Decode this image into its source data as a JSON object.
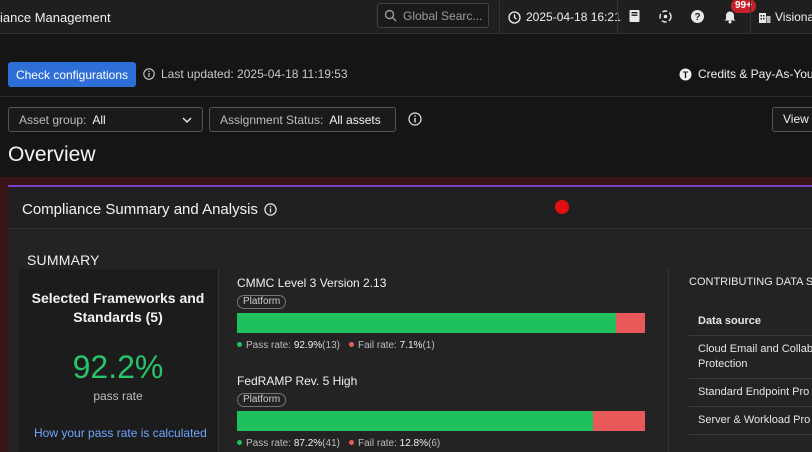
{
  "topbar": {
    "app_title": "iance Management",
    "search_placeholder": "Global Searc...",
    "datetime": "2025-04-18 16:21",
    "notifications_badge": "99+",
    "user_label": "Visiona"
  },
  "actions": {
    "check_configurations_label": "Check configurations",
    "last_updated": "Last updated: 2025-04-18 11:19:53",
    "credits_label": "Credits & Pay-As-You-"
  },
  "filters": {
    "asset_group_label": "Asset group:",
    "asset_group_value": "All",
    "assignment_status_label": "Assignment Status:",
    "assignment_status_value": "All assets",
    "view_label": "View"
  },
  "page_title": "Overview",
  "panel": {
    "title": "Compliance Summary and Analysis",
    "summary_label": "SUMMARY",
    "selected_frameworks": "Selected Frameworks and Standards (5)",
    "pass_rate_value": "92.2%",
    "pass_rate_label": "pass rate",
    "how_link": "How your pass rate is calculated"
  },
  "frameworks": [
    {
      "name": "CMMC Level 3 Version 2.13",
      "tag": "Platform",
      "pass_fraction": 0.929,
      "pass_label": "Pass rate:",
      "pass_value": "92.9%",
      "pass_count": "(13)",
      "fail_label": "Fail rate:",
      "fail_value": "7.1%",
      "fail_count": "(1)"
    },
    {
      "name": "FedRAMP Rev. 5 High",
      "tag": "Platform",
      "pass_fraction": 0.872,
      "pass_label": "Pass rate:",
      "pass_value": "87.2%",
      "pass_count": "(41)",
      "fail_label": "Fail rate:",
      "fail_value": "12.8%",
      "fail_count": "(6)"
    }
  ],
  "contributing": {
    "title": "CONTRIBUTING DATA SO",
    "header": "Data source",
    "rows": [
      "Cloud Email and Collab",
      "Protection",
      "Standard Endpoint Pro",
      "Server & Workload Pro"
    ]
  },
  "colors": {
    "primary": "#2d6fd6",
    "pass": "#1ec15c",
    "fail": "#e85a5a",
    "accent": "#7b3fc4",
    "link": "#6ea6ff"
  }
}
